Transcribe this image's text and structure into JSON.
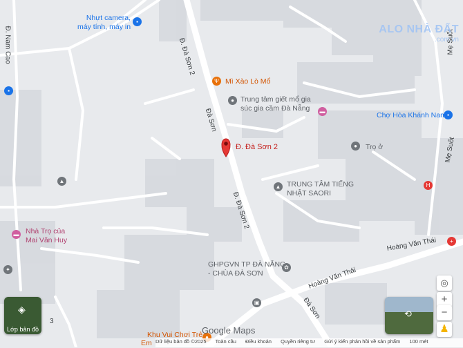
{
  "pois": {
    "camera": "Nhựt camera,\nmáy tính, máy in",
    "mi_xao": "Mì Xào Lò Mổ",
    "tt_giet_mo_1": "Trung tâm giết mổ gia",
    "tt_giet_mo_2": "súc gia cầm Đà Nẵng",
    "selected": "Đ. Đà Sơn 2",
    "cho": "Chợ Hòa Khánh Nam",
    "tro_o": "Trọ ở",
    "tt_tieng_1": "TRUNG TÂM TIẾNG",
    "tt_tieng_2": "NHẬT SAORI",
    "nha_tro_1": "Nhà Trọ của",
    "nha_tro_2": "Mai Văn Huy",
    "ghpgvn_1": "GHPGVN TP ĐÀ NẴNG",
    "ghpgvn_2": "- CHÙA ĐÀ SƠN",
    "khu_vui": "Khu Vui Chơi Trẻ",
    "em": "Em"
  },
  "roads": {
    "da_son_2_top": "Đ. Đà Sơn 2",
    "da_son_mid": "Đà Sơn",
    "da_son_2_bottom": "Đ. Đà Sơn 2",
    "hoang_van_thai_1": "Hoàng Văn Thái",
    "hoang_van_thai_2": "Hoàng Văn Thái",
    "da_son_bottom": "Đà Sơn",
    "nam_cao": "Đ. Nam Cao",
    "me_suot_1": "Mẹ Suốt",
    "me_suot_2": "Mẹ Suốt",
    "road_3": "3"
  },
  "watermark": {
    "line1": "ALO NHÀ ĐẤT",
    "line2": ".com.vn"
  },
  "controls": {
    "layers_label": "Lớp bản đồ",
    "zoom_in": "+",
    "zoom_out": "−"
  },
  "branding": {
    "google": "Google",
    "maps": "Maps"
  },
  "footer": {
    "data": "Dữ liệu bản đồ ©2025",
    "global": "Toàn cầu",
    "terms": "Điều khoản",
    "privacy": "Quyền riêng tư",
    "feedback": "Gửi ý kiến phản hồi về sản phẩm",
    "scale": "100 mét"
  },
  "colors": {
    "land": "#e8eaed",
    "road": "#ffffff",
    "major_road": "#f8f9fa",
    "building": "#d6d9de",
    "pin": "#e53935"
  }
}
